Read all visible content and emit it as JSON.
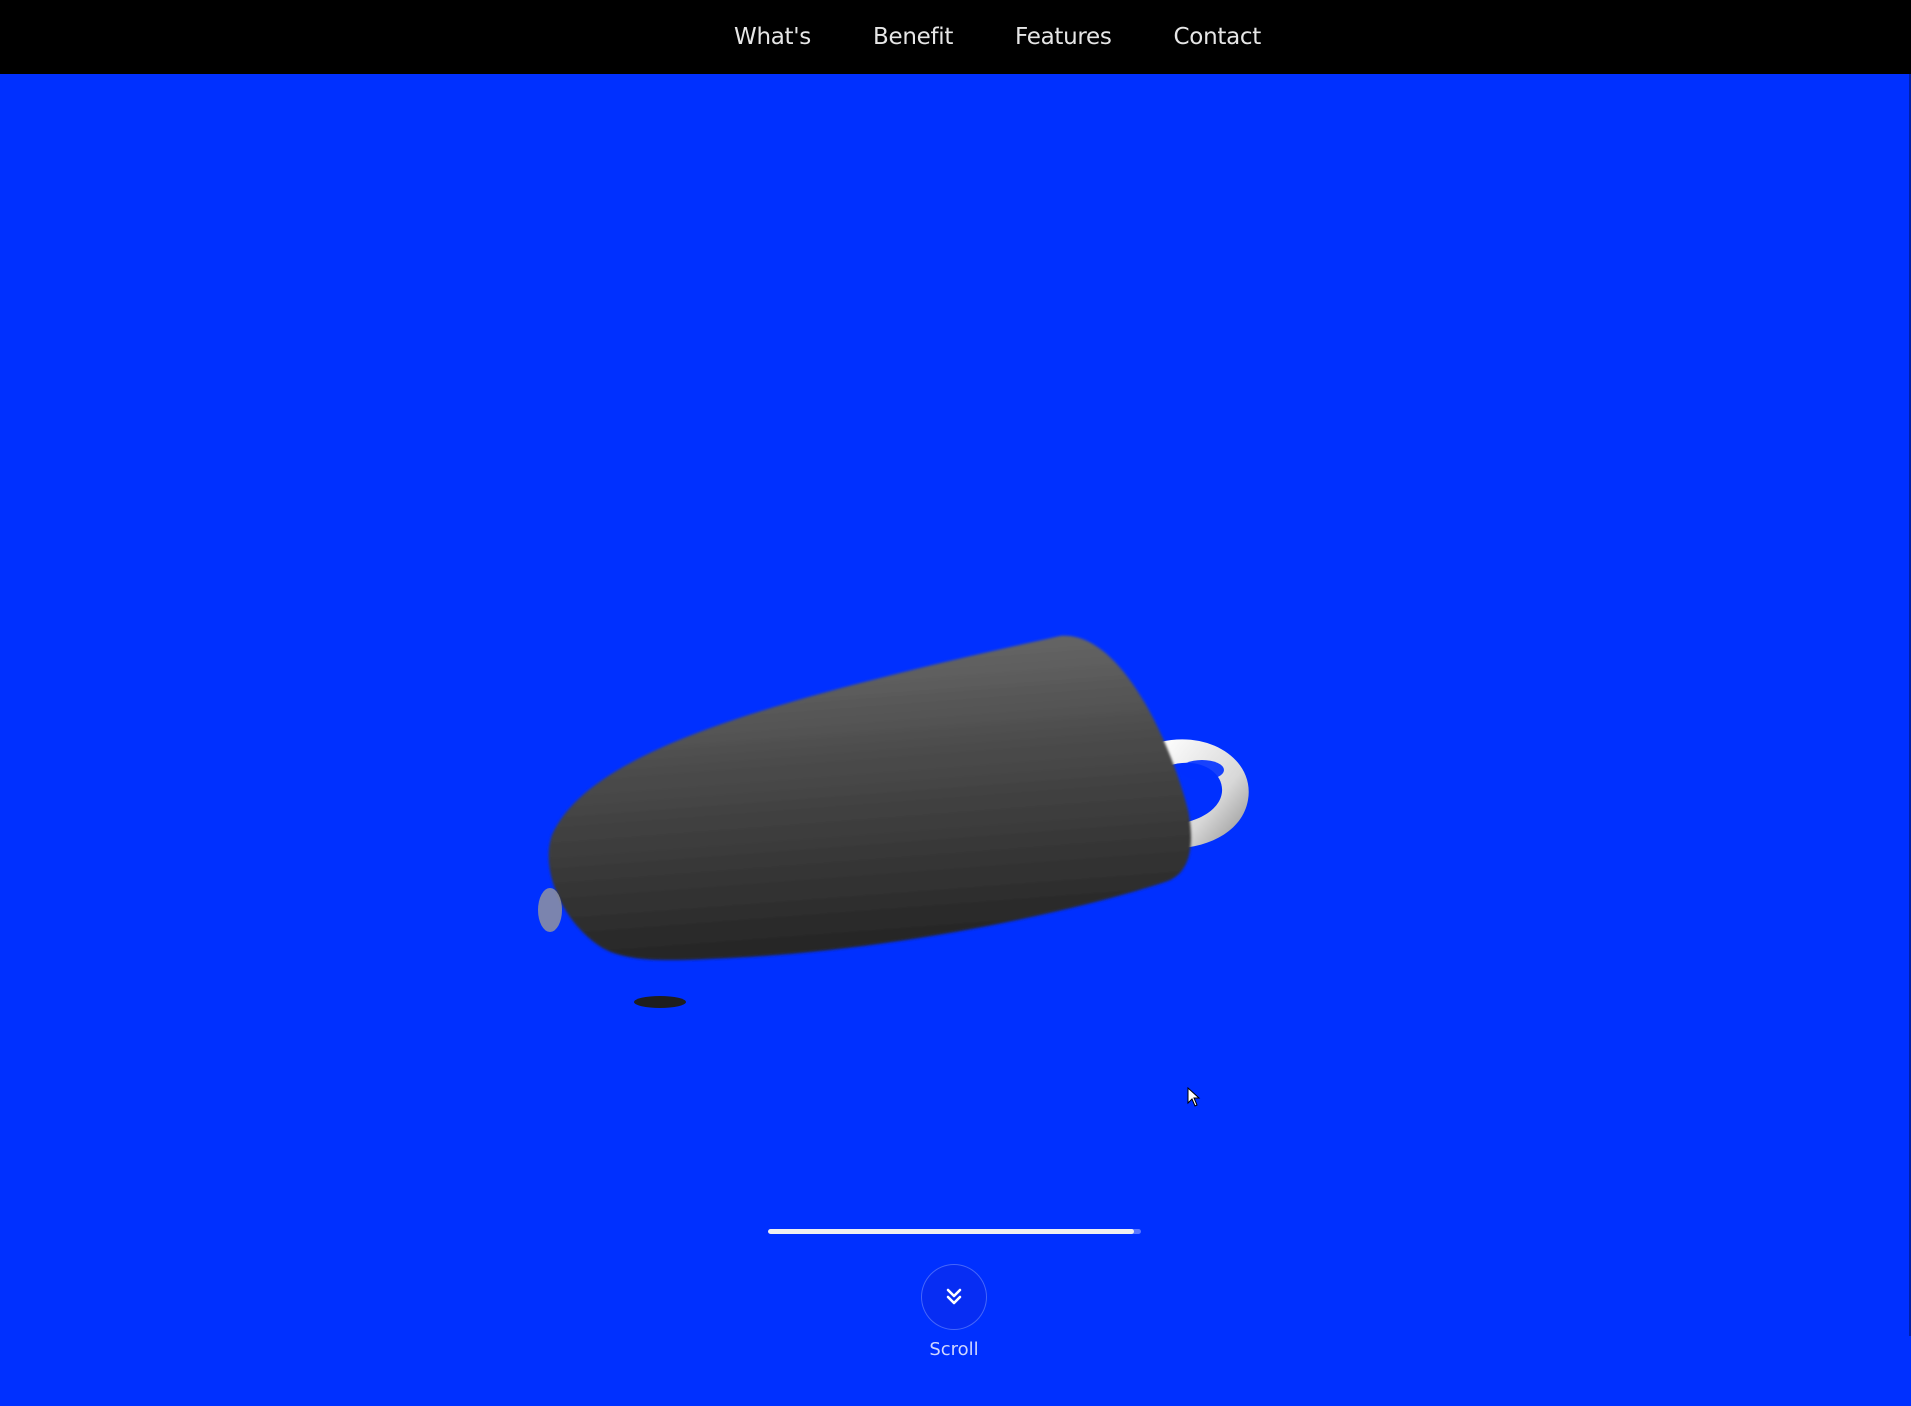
{
  "nav": {
    "items": [
      {
        "label": "What's"
      },
      {
        "label": "Benefit"
      },
      {
        "label": "Features"
      },
      {
        "label": "Contact"
      }
    ]
  },
  "hero": {
    "background_color": "#0030ff",
    "product_icon": "product-3d-model-icon",
    "progress": 0.98,
    "scroll_label": "Scroll",
    "scroll_icon": "double-chevron-down-icon"
  },
  "colors": {
    "nav_background": "#000000",
    "nav_text": "#e6e6e6",
    "progress_fill": "#f0f0f0"
  }
}
